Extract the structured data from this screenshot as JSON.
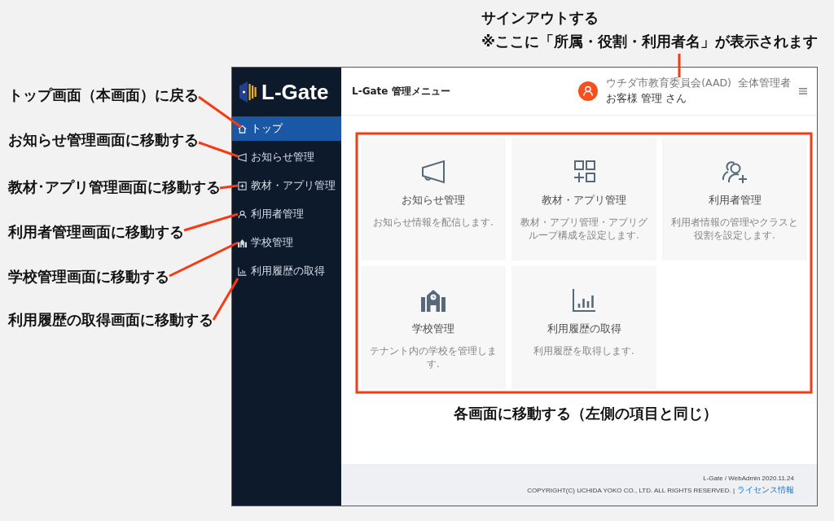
{
  "annotations": {
    "top": [
      "サインアウトする",
      "※ここに「所属・役割・利用者名」が表示されます"
    ],
    "left": [
      "トップ画面（本画面）に戻る",
      "お知らせ管理画面に移動する",
      "教材･アプリ管理画面に移動する",
      "利用者管理画面に移動する",
      "学校管理画面に移動する",
      "利用履歴の取得画面に移動する"
    ],
    "bottom": "各画面に移動する（左側の項目と同じ）"
  },
  "app": {
    "logo": "L-Gate",
    "sidebar": {
      "items": [
        {
          "kind": "home",
          "label": "トップ",
          "selected": true
        },
        {
          "kind": "notice",
          "label": "お知らせ管理",
          "selected": false
        },
        {
          "kind": "apps",
          "label": "教材・アプリ管理",
          "selected": false
        },
        {
          "kind": "users",
          "label": "利用者管理",
          "selected": false
        },
        {
          "kind": "school",
          "label": "学校管理",
          "selected": false
        },
        {
          "kind": "history",
          "label": "利用履歴の取得",
          "selected": false
        }
      ]
    },
    "header": {
      "title": "L-Gate 管理メニュー",
      "affiliation": "ウチダ市教育委員会(AAD)",
      "role": "全体管理者",
      "user_name": "お客様 管理 さん"
    },
    "cards": [
      {
        "kind": "notice",
        "title": "お知らせ管理",
        "description": "お知らせ情報を配信します."
      },
      {
        "kind": "apps",
        "title": "教材・アプリ管理",
        "description": "教材・アプリ管理・アプリグループ構成を設定します."
      },
      {
        "kind": "users",
        "title": "利用者管理",
        "description": "利用者情報の管理やクラスと役割を設定します."
      },
      {
        "kind": "school",
        "title": "学校管理",
        "description": "テナント内の学校を管理します."
      },
      {
        "kind": "history",
        "title": "利用履歴の取得",
        "description": "利用履歴を取得します."
      }
    ],
    "footer": {
      "version": "L-Gate / WebAdmin 2020.11.24",
      "copyright": "COPYRIGHT(C) UCHIDA YOKO CO., LTD. ALL RIGHTS RESERVED. |",
      "link": "ライセンス情報"
    }
  }
}
